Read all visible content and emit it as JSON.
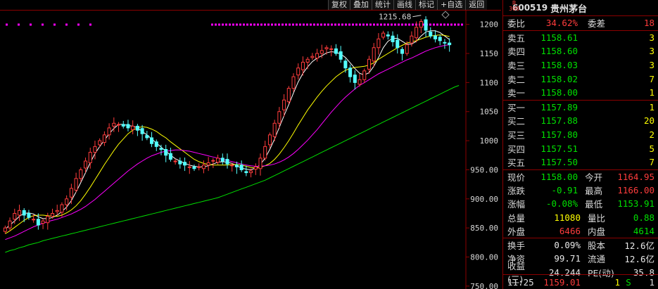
{
  "toolbar": [
    "复权",
    "叠加",
    "统计",
    "画线",
    "标记",
    "+自选",
    "返回"
  ],
  "header": {
    "badge_top": "R",
    "badge_bottom": "300",
    "code": "600519",
    "name": "贵州茅台"
  },
  "quote": {
    "webi_label": "委比",
    "webi_value": "34.62%",
    "weicha_label": "委差",
    "weicha_value": "18",
    "asks": [
      {
        "label": "卖五",
        "price": "1158.61",
        "volume": "3"
      },
      {
        "label": "卖四",
        "price": "1158.60",
        "volume": "3"
      },
      {
        "label": "卖三",
        "price": "1158.03",
        "volume": "3"
      },
      {
        "label": "卖二",
        "price": "1158.02",
        "volume": "7"
      },
      {
        "label": "卖一",
        "price": "1158.00",
        "volume": "1"
      }
    ],
    "bids": [
      {
        "label": "买一",
        "price": "1157.89",
        "volume": "1"
      },
      {
        "label": "买二",
        "price": "1157.88",
        "volume": "20"
      },
      {
        "label": "买三",
        "price": "1157.80",
        "volume": "2"
      },
      {
        "label": "买四",
        "price": "1157.51",
        "volume": "5"
      },
      {
        "label": "买五",
        "price": "1157.50",
        "volume": "7"
      }
    ],
    "stats1": [
      {
        "l1": "现价",
        "v1": "1158.00",
        "c1": "green",
        "l2": "今开",
        "v2": "1164.95",
        "c2": "red"
      },
      {
        "l1": "涨跌",
        "v1": "-0.91",
        "c1": "green",
        "l2": "最高",
        "v2": "1166.00",
        "c2": "red"
      },
      {
        "l1": "涨幅",
        "v1": "-0.08%",
        "c1": "green",
        "l2": "最低",
        "v2": "1153.91",
        "c2": "green"
      },
      {
        "l1": "总量",
        "v1": "11080",
        "c1": "yellow",
        "l2": "量比",
        "v2": "0.88",
        "c2": "green"
      },
      {
        "l1": "外盘",
        "v1": "6466",
        "c1": "red",
        "l2": "内盘",
        "v2": "4614",
        "c2": "green"
      }
    ],
    "stats2": [
      {
        "l1": "换手",
        "v1": "0.09%",
        "c1": "white",
        "l2": "股本",
        "v2": "12.6亿",
        "c2": "white"
      },
      {
        "l1": "净资",
        "v1": "99.71",
        "c1": "white",
        "l2": "流通",
        "v2": "12.6亿",
        "c2": "white"
      },
      {
        "l1": "收益(三)",
        "v1": "24.244",
        "c1": "white",
        "l2": "PE(动)",
        "v2": "35.8",
        "c2": "white"
      }
    ],
    "last_tick": {
      "time": "11:25",
      "price": "1159.01",
      "volume": "1",
      "side": "S",
      "count": "1"
    }
  },
  "chart_data": {
    "type": "candlestick",
    "ylim": [
      745,
      1225
    ],
    "yticks": [
      "1200",
      "1150",
      "1100",
      "1050",
      "1000",
      "950.00",
      "900.00",
      "850.00",
      "800.00",
      "750.00"
    ],
    "ytick_values": [
      1200,
      1150,
      1100,
      1050,
      1000,
      950,
      900,
      850,
      800,
      750
    ],
    "annotation": {
      "text": "1215.68",
      "value": 1215.68
    },
    "colors": {
      "up": "#ff3c3c",
      "down": "#54ffff",
      "ma5": "#ffffff",
      "ma10": "#ffff00",
      "ma20": "#ff00ff",
      "ma60": "#00e000",
      "dots": "#ff00ff"
    },
    "series": [
      {
        "name": "close",
        "values": [
          850,
          862,
          875,
          880,
          872,
          868,
          865,
          855,
          862,
          870,
          875,
          880,
          890,
          900,
          918,
          935,
          950,
          965,
          980,
          990,
          1000,
          1010,
          1022,
          1030,
          1028,
          1025,
          1022,
          1025,
          1018,
          1012,
          1005,
          995,
          990,
          985,
          975,
          968,
          965,
          960,
          958,
          955,
          952,
          955,
          958,
          962,
          966,
          970,
          965,
          960,
          958,
          955,
          950,
          945,
          948,
          955,
          970,
          990,
          1010,
          1030,
          1050,
          1070,
          1090,
          1110,
          1125,
          1135,
          1140,
          1145,
          1150,
          1155,
          1160,
          1158,
          1150,
          1140,
          1125,
          1110,
          1100,
          1105,
          1120,
          1140,
          1160,
          1175,
          1185,
          1180,
          1170,
          1160,
          1150,
          1165,
          1180,
          1195,
          1205,
          1190,
          1180,
          1175,
          1172,
          1168,
          1165
        ]
      },
      {
        "name": "ma5",
        "values": [
          848,
          855,
          862,
          870,
          875,
          876,
          874,
          869,
          866,
          866,
          868,
          872,
          878,
          886,
          897,
          912,
          928,
          945,
          962,
          978,
          990,
          1001,
          1012,
          1021,
          1028,
          1028,
          1026,
          1025,
          1022,
          1016,
          1010,
          1003,
          996,
          989,
          982,
          975,
          969,
          965,
          961,
          958,
          956,
          955,
          955,
          957,
          960,
          963,
          964,
          963,
          961,
          957,
          953,
          951,
          950,
          953,
          959,
          970,
          985,
          1003,
          1023,
          1043,
          1062,
          1082,
          1101,
          1116,
          1127,
          1136,
          1142,
          1146,
          1151,
          1153,
          1152,
          1149,
          1143,
          1134,
          1124,
          1116,
          1113,
          1117,
          1128,
          1143,
          1160,
          1171,
          1176,
          1176,
          1171,
          1166,
          1166,
          1171,
          1180,
          1187,
          1189,
          1189,
          1186,
          1180,
          1174
        ]
      },
      {
        "name": "ma10",
        "values": [
          840,
          845,
          851,
          857,
          863,
          868,
          871,
          872,
          872,
          871,
          870,
          870,
          872,
          876,
          881,
          888,
          897,
          908,
          920,
          933,
          946,
          959,
          971,
          983,
          994,
          1003,
          1012,
          1018,
          1022,
          1024,
          1023,
          1020,
          1016,
          1010,
          1005,
          998,
          992,
          986,
          980,
          974,
          968,
          964,
          961,
          959,
          958,
          958,
          958,
          958,
          959,
          959,
          958,
          956,
          954,
          953,
          954,
          957,
          961,
          968,
          977,
          988,
          1000,
          1013,
          1027,
          1040,
          1053,
          1064,
          1075,
          1085,
          1094,
          1102,
          1110,
          1116,
          1121,
          1124,
          1126,
          1127,
          1128,
          1130,
          1134,
          1140,
          1145,
          1150,
          1155,
          1160,
          1164,
          1168,
          1170,
          1172,
          1175,
          1178,
          1180,
          1181,
          1182,
          1181,
          1179
        ]
      },
      {
        "name": "ma20",
        "values": [
          830,
          833,
          836,
          840,
          844,
          848,
          852,
          855,
          858,
          861,
          863,
          865,
          868,
          871,
          874,
          878,
          882,
          887,
          893,
          899,
          906,
          913,
          920,
          927,
          934,
          941,
          948,
          954,
          960,
          965,
          970,
          974,
          977,
          980,
          982,
          983,
          984,
          984,
          983,
          982,
          980,
          978,
          976,
          974,
          972,
          970,
          968,
          966,
          964,
          962,
          960,
          958,
          957,
          956,
          956,
          957,
          958,
          960,
          963,
          967,
          972,
          978,
          985,
          993,
          1001,
          1010,
          1019,
          1029,
          1039,
          1049,
          1058,
          1067,
          1075,
          1082,
          1089,
          1095,
          1100,
          1105,
          1110,
          1115,
          1119,
          1123,
          1127,
          1131,
          1135,
          1139,
          1142,
          1146,
          1150,
          1154,
          1157,
          1160,
          1162,
          1164,
          1165
        ]
      },
      {
        "name": "ma60",
        "values": [
          808,
          811,
          813,
          816,
          818,
          821,
          823,
          825,
          828,
          830,
          832,
          834,
          836,
          838,
          840,
          842,
          844,
          846,
          848,
          850,
          852,
          854,
          856,
          858,
          860,
          862,
          864,
          866,
          868,
          870,
          872,
          874,
          876,
          878,
          880,
          882,
          884,
          886,
          888,
          890,
          892,
          894,
          896,
          898,
          900,
          902,
          905,
          908,
          911,
          914,
          917,
          920,
          923,
          926,
          929,
          932,
          936,
          940,
          944,
          948,
          952,
          956,
          960,
          964,
          968,
          972,
          976,
          980,
          984,
          988,
          992,
          996,
          1000,
          1004,
          1008,
          1012,
          1016,
          1020,
          1024,
          1028,
          1032,
          1036,
          1040,
          1044,
          1048,
          1052,
          1056,
          1060,
          1064,
          1068,
          1072,
          1076,
          1080,
          1084,
          1088,
          1092,
          1095
        ]
      }
    ]
  }
}
